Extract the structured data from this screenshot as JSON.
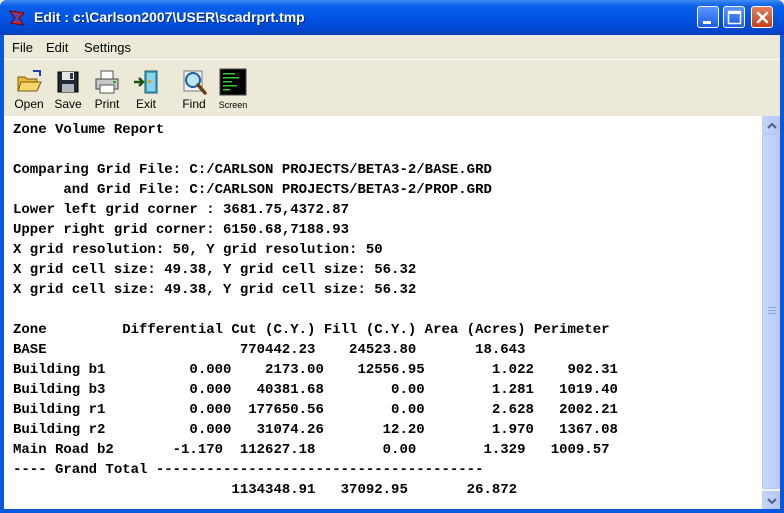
{
  "window": {
    "title": "Edit : c:\\Carlson2007\\USER\\scadrprt.tmp",
    "title_bar_color": "#0055e5",
    "controls": [
      "minimize-icon",
      "maximize-icon",
      "close-icon"
    ]
  },
  "menu": {
    "items": [
      {
        "label": "File"
      },
      {
        "label": "Edit"
      },
      {
        "label": "Settings"
      }
    ]
  },
  "toolbar": {
    "buttons": [
      {
        "label": "Open",
        "icon": "folder-open-icon"
      },
      {
        "label": "Save",
        "icon": "floppy-disk-icon"
      },
      {
        "label": "Print",
        "icon": "printer-icon"
      },
      {
        "label": "Exit",
        "icon": "exit-door-icon"
      },
      {
        "label": "Find",
        "icon": "magnifier-icon"
      },
      {
        "label": "Screen",
        "icon": "screen-icon"
      }
    ]
  },
  "report": {
    "lines": [
      "Zone Volume Report",
      "",
      "Comparing Grid File: C:/CARLSON PROJECTS/BETA3-2/BASE.GRD",
      "      and Grid File: C:/CARLSON PROJECTS/BETA3-2/PROP.GRD",
      "Lower left grid corner : 3681.75,4372.87",
      "Upper right grid corner: 6150.68,7188.93",
      "X grid resolution: 50, Y grid resolution: 50",
      "X grid cell size: 49.38, Y grid cell size: 56.32",
      "X grid cell size: 49.38, Y grid cell size: 56.32",
      "",
      "Zone         Differential Cut (C.Y.) Fill (C.Y.) Area (Acres) Perimeter",
      "BASE                       770442.23    24523.80       18.643",
      "Building b1          0.000    2173.00    12556.95        1.022    902.31",
      "Building b3          0.000   40381.68        0.00        1.281   1019.40",
      "Building r1          0.000  177650.56        0.00        2.628   2002.21",
      "Building r2          0.000   31074.26       12.20        1.970   1367.08",
      "Main Road b2       -1.170  112627.18        0.00        1.329   1009.57",
      "---- Grand Total ---------------------------------------",
      "                          1134348.91   37092.95       26.872"
    ]
  }
}
